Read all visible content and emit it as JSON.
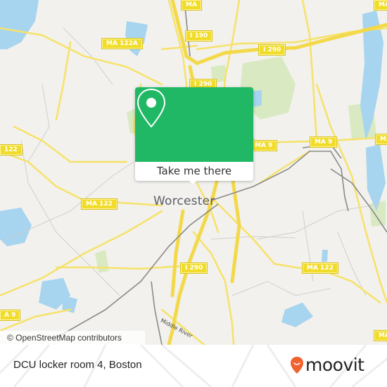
{
  "map": {
    "city_label": "Worcester",
    "street_label": "Middle River",
    "route_shields": [
      {
        "id": "ma-122a",
        "label": "MA 122A"
      },
      {
        "id": "i190",
        "label": "I 190"
      },
      {
        "id": "i290-north",
        "label": "I 290"
      },
      {
        "id": "i290-east",
        "label": "I 290"
      },
      {
        "id": "i290-south",
        "label": "I 290"
      },
      {
        "id": "ma122-west-edge",
        "label": "122"
      },
      {
        "id": "ma122-west",
        "label": "MA 122"
      },
      {
        "id": "ma122-east",
        "label": "MA 122"
      },
      {
        "id": "ma9-center",
        "label": "MA 9"
      },
      {
        "id": "ma9-east",
        "label": "MA 9"
      },
      {
        "id": "ma9-east-edge",
        "label": "MA"
      },
      {
        "id": "ma9-west-edge",
        "label": "A 9"
      },
      {
        "id": "ma-top",
        "label": "MA"
      },
      {
        "id": "ma-bottom-edge",
        "label": "MA"
      }
    ],
    "attribution": "© OpenStreetMap contributors"
  },
  "popup": {
    "icon": "location-pin-icon",
    "button_label": "Take me there",
    "accent_color": "#20b865"
  },
  "footer": {
    "place_name": "DCU locker room 4, Boston",
    "brand": "moovit",
    "brand_color": "#f0622f"
  }
}
